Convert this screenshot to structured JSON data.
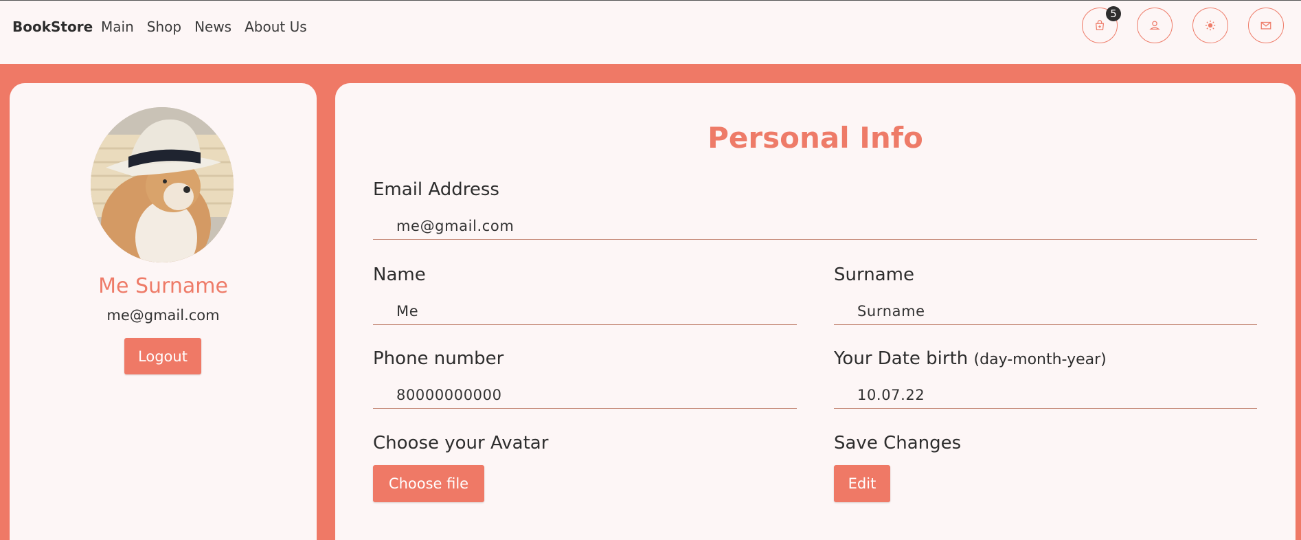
{
  "navbar": {
    "brand": "BookStore",
    "links": [
      "Main",
      "Shop",
      "News",
      "About Us"
    ],
    "cart_count": "5",
    "icons": [
      "cart-icon",
      "user-icon",
      "sun-icon",
      "mail-icon"
    ]
  },
  "profile": {
    "name": "Me Surname",
    "email": "me@gmail.com",
    "logout_label": "Logout"
  },
  "form": {
    "title": "Personal Info",
    "email_label": "Email Address",
    "email_value": "me@gmail.com",
    "name_label": "Name",
    "name_value": "Me",
    "surname_label": "Surname",
    "surname_value": "Surname",
    "phone_label": "Phone number",
    "phone_value": "80000000000",
    "dob_label": "Your Date birth",
    "dob_hint": "(day-month-year)",
    "dob_value": "10.07.22",
    "avatar_label": "Choose your Avatar",
    "choose_file_label": "Choose file",
    "save_label": "Save Changes",
    "edit_label": "Edit"
  },
  "colors": {
    "accent": "#ef7966",
    "card": "#fdf6f6",
    "text": "#2d2d2d"
  }
}
